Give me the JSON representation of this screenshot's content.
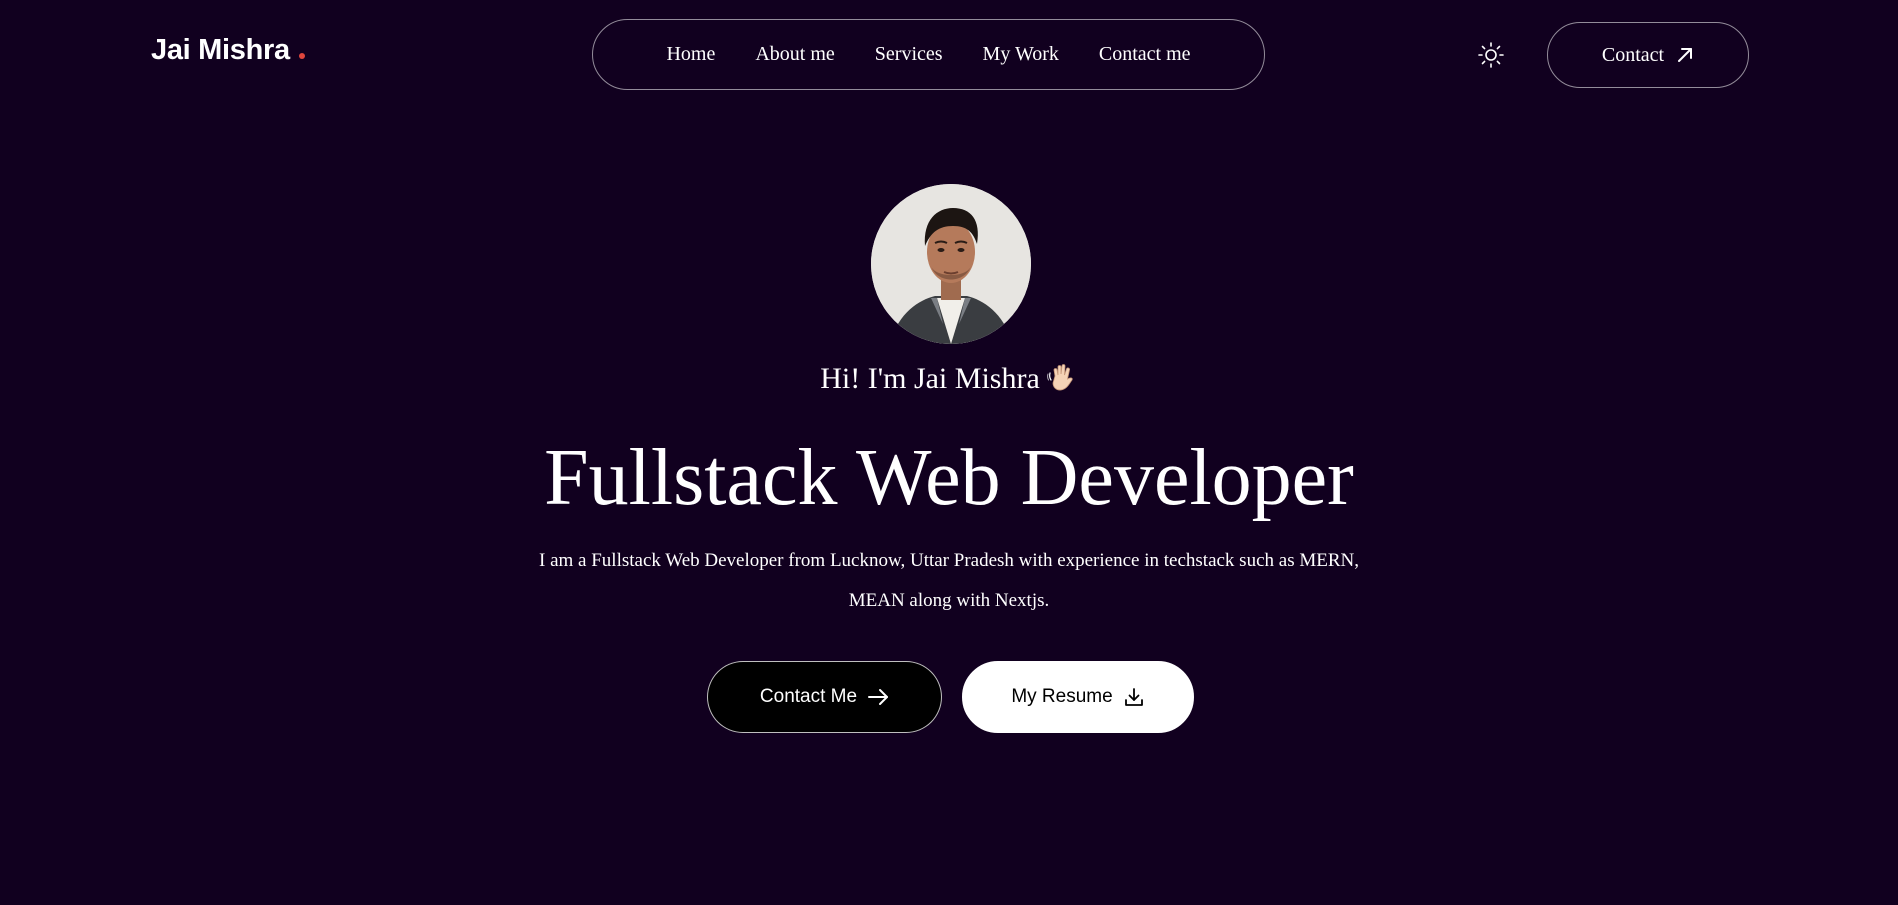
{
  "header": {
    "logo_text": "Jai Mishra",
    "logo_dot_color": "#e0463d",
    "nav": [
      {
        "label": "Home"
      },
      {
        "label": "About me"
      },
      {
        "label": "Services"
      },
      {
        "label": "My Work"
      },
      {
        "label": "Contact me"
      }
    ],
    "theme_icon": "sun-icon",
    "contact_button": {
      "label": "Contact",
      "icon": "arrow-up-right-icon"
    }
  },
  "hero": {
    "avatar_icon": "profile-photo",
    "greeting": "Hi! I'm Jai Mishra",
    "greeting_icon": "waving-hand-icon",
    "headline": "Fullstack Web Developer",
    "description": "I am a Fullstack Web Developer from Lucknow, Uttar Pradesh with experience in techstack such as MERN, MEAN along with Nextjs.",
    "buttons": [
      {
        "label": "Contact Me",
        "icon": "arrow-right-icon"
      },
      {
        "label": "My Resume",
        "icon": "download-icon"
      }
    ]
  },
  "colors": {
    "background": "#11001f",
    "text": "#ffffff",
    "accent": "#e0463d"
  }
}
